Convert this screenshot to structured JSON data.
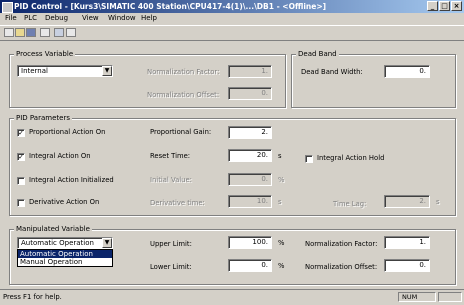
{
  "window": {
    "title": "PID Control - [Kurs3\\SIMATIC 400 Station\\CPU417-4(1)\\...\\DB1 - <Offline>]"
  },
  "menu": [
    "File",
    "PLC",
    "Debug",
    "View",
    "Window",
    "Help"
  ],
  "toolbar": {
    "icons": [
      "new-icon",
      "open-icon",
      "save-icon",
      "print-icon",
      "download-icon",
      "monitor-icon"
    ]
  },
  "process_variable": {
    "title": "Process Variable",
    "source_value": "Internal",
    "norm_factor_label": "Normalization Factor:",
    "norm_factor_value": "1.",
    "norm_offset_label": "Normalization Offset:",
    "norm_offset_value": "0."
  },
  "dead_band": {
    "title": "Dead Band",
    "width_label": "Dead Band Width:",
    "width_value": "0."
  },
  "pid": {
    "title": "PID Parameters",
    "p_check_label": "Proportional Action On",
    "p_checked": "✓",
    "gain_label": "Proportional Gain:",
    "gain_value": "2.",
    "i_check_label": "Integral Action On",
    "i_checked": "✓",
    "reset_label": "Reset Time:",
    "reset_value": "20.",
    "reset_unit": "s",
    "hold_label": "Integral Action Hold",
    "init_check_label": "Integral Action Initialized",
    "init_label": "Initial Value:",
    "init_value": "0.",
    "init_unit": "%",
    "d_check_label": "Derivative Action On",
    "deriv_label": "Derivative time:",
    "deriv_value": "10.",
    "deriv_unit": "s",
    "lag_label": "Time Lag:",
    "lag_value": "2.",
    "lag_unit": "s"
  },
  "manipulated": {
    "title": "Manipulated Variable",
    "mode_value": "Automatic Operation",
    "options": [
      "Automatic Operation",
      "Manual Operation"
    ],
    "upper_label": "Upper Limit:",
    "upper_value": "100.",
    "upper_unit": "%",
    "lower_label": "Lower Limit:",
    "lower_value": "0.",
    "lower_unit": "%",
    "norm_factor_label": "Normalization Factor:",
    "norm_factor_value": "1.",
    "norm_offset_label": "Normalization Offset:",
    "norm_offset_value": "0."
  },
  "status": {
    "help": "Press F1 for help.",
    "mode": "NUM"
  }
}
